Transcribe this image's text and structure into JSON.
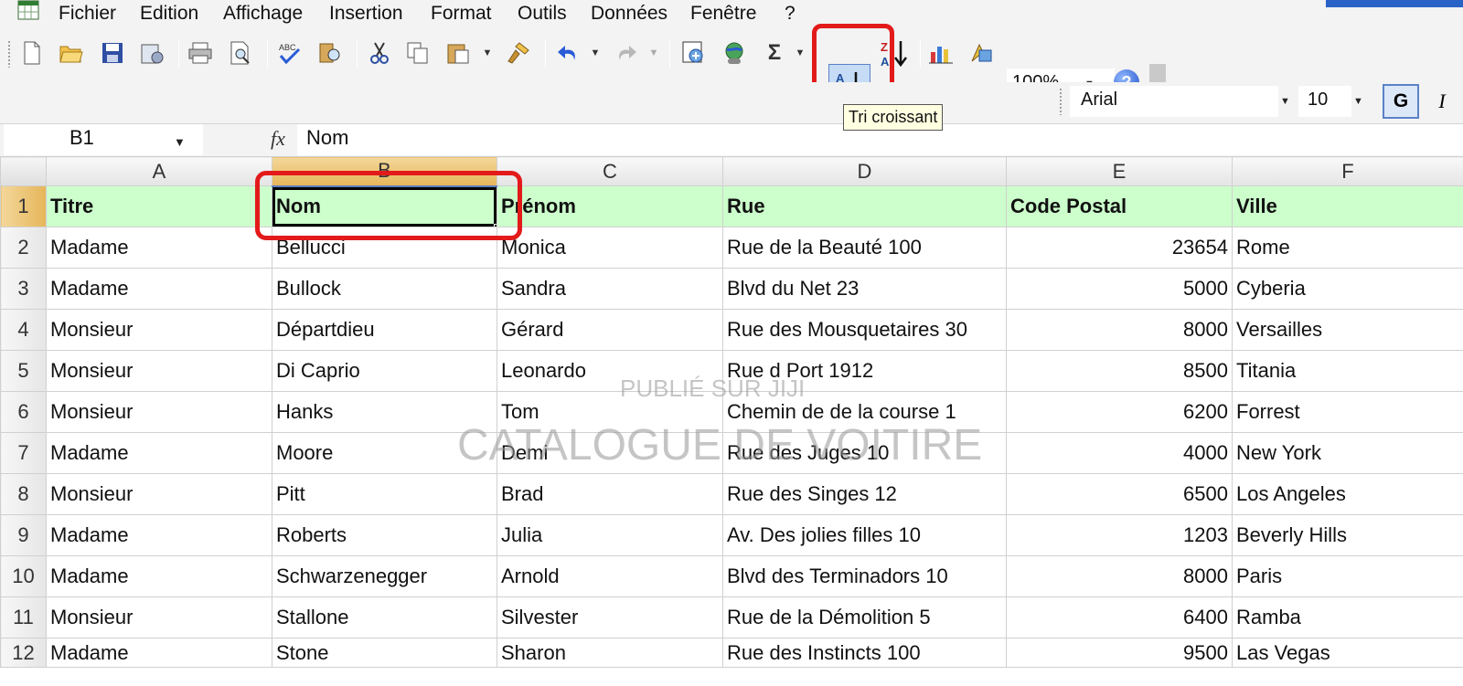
{
  "menu": {
    "items": [
      "Fichier",
      "Edition",
      "Affichage",
      "Insertion",
      "Format",
      "Outils",
      "Données",
      "Fenêtre",
      "?"
    ]
  },
  "toolbar": {
    "zoom": "100%",
    "font_name": "Arial",
    "font_size": "10",
    "bold_label": "G",
    "italic_label": "I",
    "sigma_label": "Σ",
    "help_label": "?",
    "tooltip": "Tri croissant"
  },
  "formula_bar": {
    "name_box": "B1",
    "fx": "fx",
    "content": "Nom"
  },
  "sheet": {
    "columns": [
      "A",
      "B",
      "C",
      "D",
      "E",
      "F"
    ],
    "header": [
      "Titre",
      "Nom",
      "Prénom",
      "Rue",
      "Code Postal",
      "Ville"
    ],
    "rows": [
      [
        "Madame",
        "Bellucci",
        "Monica",
        "Rue de la Beauté 100",
        "23654",
        "Rome"
      ],
      [
        "Madame",
        "Bullock",
        "Sandra",
        "Blvd du Net 23",
        "5000",
        "Cyberia"
      ],
      [
        "Monsieur",
        "Départdieu",
        "Gérard",
        "Rue des Mousquetaires 30",
        "8000",
        "Versailles"
      ],
      [
        "Monsieur",
        "Di Caprio",
        "Leonardo",
        "Rue d Port 1912",
        "8500",
        "Titania"
      ],
      [
        "Monsieur",
        "Hanks",
        "Tom",
        "Chemin de de la course 1",
        "6200",
        "Forrest"
      ],
      [
        "Madame",
        "Moore",
        "Demi",
        "Rue des Juges 10",
        "4000",
        "New York"
      ],
      [
        "Monsieur",
        "Pitt",
        "Brad",
        "Rue des Singes 12",
        "6500",
        "Los Angeles"
      ],
      [
        "Madame",
        "Roberts",
        "Julia",
        "Av. Des jolies filles 10",
        "1203",
        "Beverly Hills"
      ],
      [
        "Madame",
        "Schwarzenegger",
        "Arnold",
        "Blvd des Terminadors 10",
        "8000",
        "Paris"
      ],
      [
        "Monsieur",
        "Stallone",
        "Silvester",
        "Rue de la Démolition 5",
        "6400",
        "Ramba"
      ],
      [
        "Madame",
        "Stone",
        "Sharon",
        "Rue des Instincts 100",
        "9500",
        "Las Vegas"
      ]
    ]
  },
  "watermark": {
    "line1": "PUBLIÉ SUR JIJI",
    "line2": "CATALOGUE DE VOITIRE"
  },
  "colors": {
    "header_row_bg": "#ccffcc",
    "highlight_outline": "#e31a1a",
    "active_header": "#e6b65a"
  },
  "icons": [
    "excel-app-icon",
    "new-icon",
    "open-icon",
    "save-icon",
    "permission-icon",
    "print-icon",
    "print-preview-icon",
    "spelling-icon",
    "research-icon",
    "cut-icon",
    "copy-icon",
    "paste-icon",
    "format-painter-icon",
    "undo-icon",
    "redo-icon",
    "hyperlink-icon",
    "web-icon",
    "autosum-icon",
    "sort-ascending-icon",
    "sort-descending-icon",
    "chart-wizard-icon",
    "drawing-icon",
    "help-icon"
  ]
}
